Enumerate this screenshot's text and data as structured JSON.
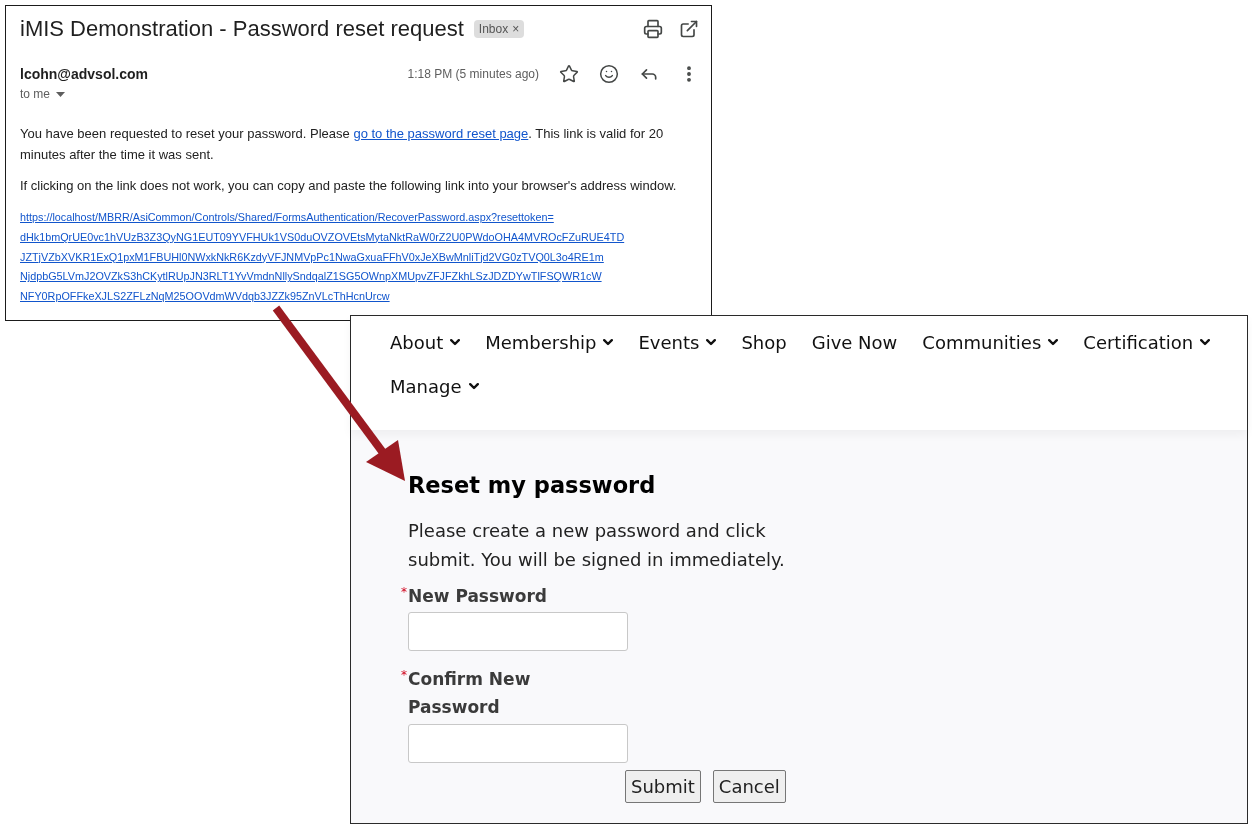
{
  "email": {
    "subject": "iMIS Demonstration - Password reset request",
    "label_tag": {
      "text": "Inbox",
      "remove": "×"
    },
    "sender": "lcohn@advsol.com",
    "recipient": "to me",
    "time": "1:18 PM (5 minutes ago)",
    "paragraphs": [
      {
        "parts": [
          {
            "text": "You have been requested to reset your password. Please ",
            "link": false
          },
          {
            "text": "go to the password reset page",
            "link": true
          },
          {
            "text": ". This link is valid for 20 minutes after the time it was sent.",
            "link": false
          }
        ]
      },
      {
        "parts": [
          {
            "text": "If clicking on the link does not work, you can copy and paste the following link into your browser's address window.",
            "link": false
          }
        ]
      }
    ],
    "reset_url_lines": [
      "https://localhost/MBRR/AsiCommon/Controls/Shared/FormsAuthentication/RecoverPassword.aspx?resettoken=",
      "dHk1bmQrUE0vc1hVUzB3Z3QyNG1EUT09YVFHUk1VS0duOVZOVEtsMytaNktRaW0rZ2U0PWdoOHA4MVROcFZuRUE4TD",
      "JZTjVZbXVKR1ExQ1pxM1FBUHl0NWxkNkR6KzdyVFJNMVpPc1NwaGxuaFFhV0xJeXBwMnliTjd2VG0zTVQ0L3o4RE1m",
      "NjdpbG5LVmJ2OVZkS3hCKytlRUpJN3RLT1YvVmdnNllySndqalZ1SG5OWnpXMUpvZFJFZkhLSzJDZDYwTlFSQWR1cW",
      "NFY0RpOFFkeXJLS2ZFLzNqM25OOVdmWVdqb3JZZk95ZnVLcThHcnUrcw"
    ]
  },
  "website": {
    "nav": [
      {
        "label": "About",
        "dropdown": true
      },
      {
        "label": "Membership",
        "dropdown": true
      },
      {
        "label": "Events",
        "dropdown": true
      },
      {
        "label": "Shop",
        "dropdown": false
      },
      {
        "label": "Give Now",
        "dropdown": false
      },
      {
        "label": "Communities",
        "dropdown": true
      },
      {
        "label": "Certification",
        "dropdown": true
      },
      {
        "label": "Manage",
        "dropdown": true
      }
    ],
    "title": "Reset my password",
    "intro": "Please create a new password and click submit. You will be signed in immediately.",
    "fields": [
      {
        "label": "New Password",
        "required_mark": "*"
      },
      {
        "label": "Confirm New Password",
        "required_mark": "*"
      }
    ],
    "buttons": [
      "Submit",
      "Cancel"
    ]
  }
}
